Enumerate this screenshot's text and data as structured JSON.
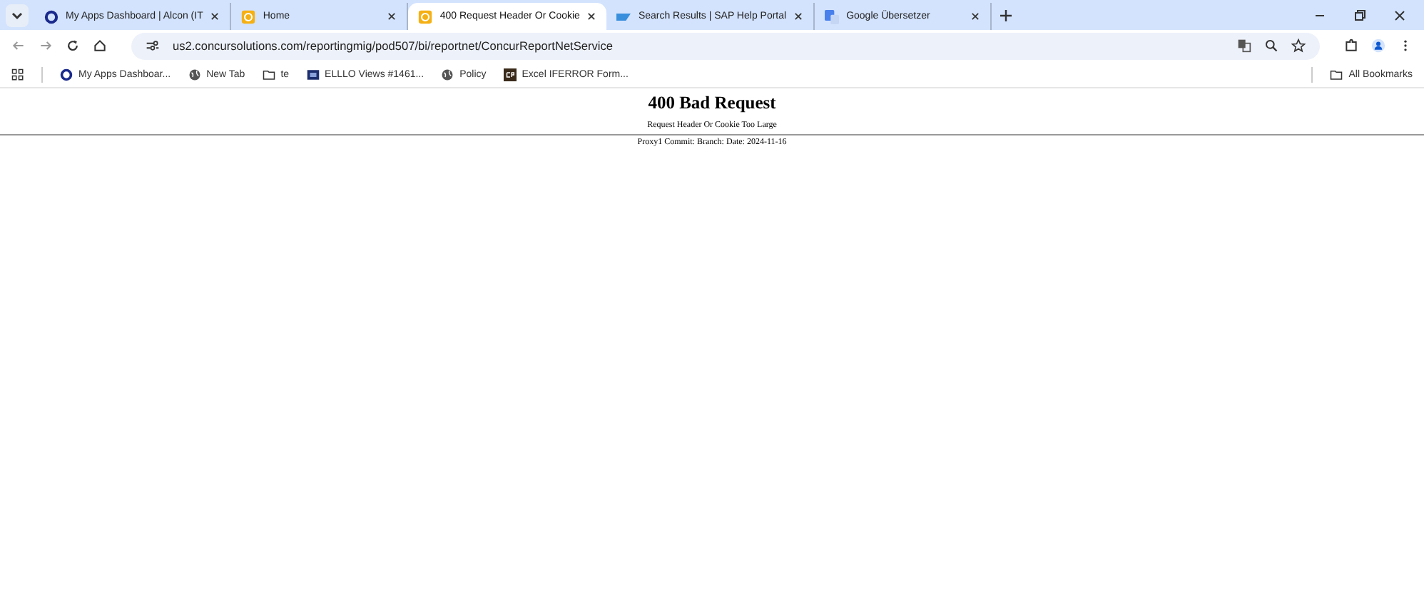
{
  "tabs": [
    {
      "title": "My Apps Dashboard | Alcon (IT",
      "selected": false
    },
    {
      "title": "Home",
      "selected": false
    },
    {
      "title": "400 Request Header Or Cookie",
      "selected": true
    },
    {
      "title": "Search Results | SAP Help Portal",
      "selected": false
    },
    {
      "title": "Google Übersetzer",
      "selected": false
    }
  ],
  "address_bar": {
    "url": "us2.concursolutions.com/reportingmig/pod507/bi/reportnet/ConcurReportNetService"
  },
  "bookmarks": [
    {
      "label": "My Apps Dashboar..."
    },
    {
      "label": "New Tab"
    },
    {
      "label": "te"
    },
    {
      "label": "ELLLO Views #1461..."
    },
    {
      "label": "Policy"
    },
    {
      "label": "Excel IFERROR Form..."
    }
  ],
  "all_bookmarks": "All Bookmarks",
  "page": {
    "heading": "400 Bad Request",
    "message": "Request Header Or Cookie Too Large",
    "footer": "Proxy1 Commit: Branch: Date: 2024-11-16"
  }
}
